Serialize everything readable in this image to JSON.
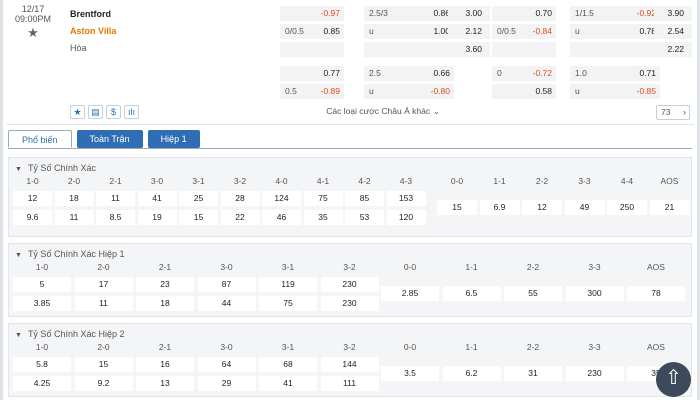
{
  "match": {
    "date": "12/17",
    "time": "09:00PM",
    "home": "Brentford",
    "away": "Aston Villa",
    "draw": "Hòa"
  },
  "odds_top": {
    "a": [
      {
        "val": "-0.97"
      },
      {
        "lbl": "0/0.5",
        "val": "0.85"
      },
      {
        "val": ""
      }
    ],
    "b": [
      {
        "lbl": "2.5/3",
        "val": "0.86"
      },
      {
        "lbl": "u",
        "val": "1.00"
      },
      {
        "val": ""
      }
    ],
    "c": [
      {
        "val": "3.00"
      },
      {
        "val": "2.12"
      },
      {
        "val": "3.60"
      }
    ],
    "d": [
      {
        "val": "0.70"
      },
      {
        "lbl": "0/0.5",
        "val": "-0.84"
      },
      {
        "val": ""
      }
    ],
    "e": [
      {
        "lbl": "1/1.5",
        "val": "-0.92"
      },
      {
        "lbl": "u",
        "val": "0.78"
      },
      {
        "val": ""
      }
    ],
    "f": [
      {
        "val": "3.90"
      },
      {
        "val": "2.54"
      },
      {
        "val": "2.22"
      }
    ]
  },
  "odds_bottom": {
    "a": [
      {
        "val": "0.77"
      },
      {
        "lbl": "0.5",
        "val": "-0.89"
      }
    ],
    "b": [
      {
        "lbl": "2.5",
        "val": "0.66"
      },
      {
        "lbl": "u",
        "val": "-0.80"
      }
    ],
    "d": [
      {
        "lbl": "0",
        "val": "-0.72"
      },
      {
        "val": "0.58"
      }
    ],
    "e": [
      {
        "lbl": "1.0",
        "val": "0.71"
      },
      {
        "lbl": "u",
        "val": "-0.85"
      }
    ]
  },
  "toolbar": {
    "asia_label": "Các loại cược Châu Á khác",
    "count": "73"
  },
  "tabs": [
    "Phổ biến",
    "Toàn Trận",
    "Hiệp 1"
  ],
  "sections": [
    {
      "title": "Tỷ Số Chính Xác",
      "groupA": {
        "headers": [
          "1-0",
          "2-0",
          "2-1",
          "3-0",
          "3-1",
          "3-2",
          "4-0",
          "4-1",
          "4-2",
          "4-3"
        ],
        "row1": [
          "12",
          "18",
          "11",
          "41",
          "25",
          "28",
          "124",
          "75",
          "85",
          "153"
        ],
        "row2": [
          "9.6",
          "11",
          "8.5",
          "19",
          "15",
          "22",
          "46",
          "35",
          "53",
          "120"
        ]
      },
      "groupB": {
        "headers": [
          "0-0",
          "1-1",
          "2-2",
          "3-3",
          "4-4",
          "AOS"
        ],
        "row": [
          "15",
          "6.9",
          "12",
          "49",
          "250",
          "21"
        ]
      }
    },
    {
      "title": "Tỷ Số Chính Xác Hiệp 1",
      "groupA": {
        "headers": [
          "1-0",
          "2-0",
          "2-1",
          "3-0",
          "3-1",
          "3-2"
        ],
        "row1": [
          "5",
          "17",
          "23",
          "87",
          "119",
          "230"
        ],
        "row2": [
          "3.85",
          "11",
          "18",
          "44",
          "75",
          "230"
        ]
      },
      "groupB": {
        "headers": [
          "0-0",
          "1-1",
          "2-2",
          "3-3",
          "AOS"
        ],
        "row": [
          "2.85",
          "6.5",
          "55",
          "300",
          "78"
        ]
      }
    },
    {
      "title": "Tỷ Số Chính Xác Hiệp 2",
      "groupA": {
        "headers": [
          "1-0",
          "2-0",
          "2-1",
          "3-0",
          "3-1",
          "3-2"
        ],
        "row1": [
          "5.8",
          "15",
          "16",
          "64",
          "68",
          "144"
        ],
        "row2": [
          "4.25",
          "9.2",
          "13",
          "29",
          "41",
          "111"
        ]
      },
      "groupB": {
        "headers": [
          "0-0",
          "1-1",
          "2-2",
          "3-3",
          "AOS"
        ],
        "row": [
          "3.5",
          "6.2",
          "31",
          "230",
          "35"
        ]
      }
    }
  ],
  "icons": {
    "star": "star-icon",
    "list": "list-icon",
    "dollar": "dollar-icon",
    "chart": "bar-chart-icon",
    "up": "arrow-up-icon"
  }
}
